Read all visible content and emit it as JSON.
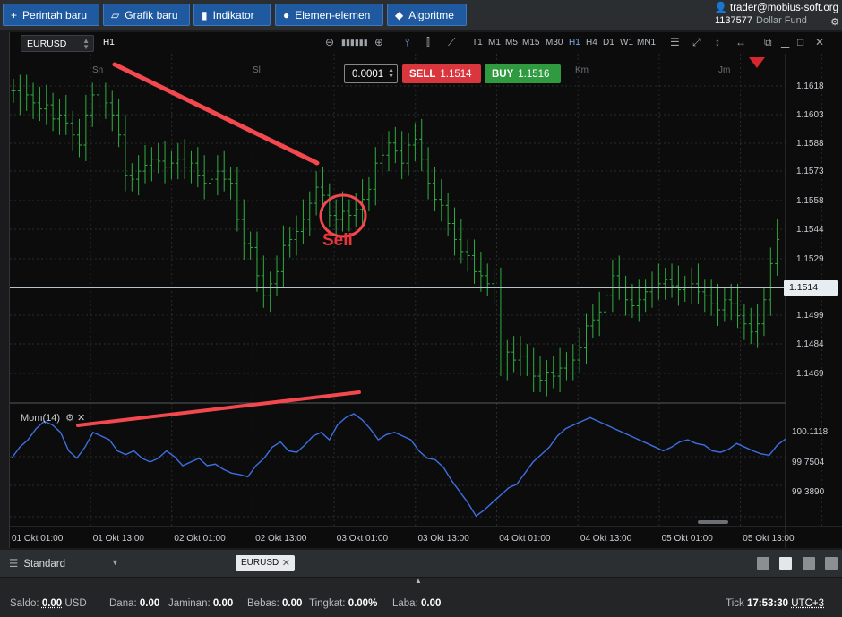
{
  "toolbar": {
    "new_order": "Perintah baru",
    "new_chart": "Grafik baru",
    "indicator": "Indikator",
    "elements": "Elemen-elemen",
    "algorithm": "Algoritme"
  },
  "account": {
    "user": "trader@mobius-soft.org",
    "account_id": "1137577",
    "fund_name": "Dollar Fund"
  },
  "chart": {
    "symbol": "EURUSD",
    "period": "H1",
    "timeframes": [
      "T1",
      "M1",
      "M5",
      "M15",
      "M30",
      "H1",
      "H4",
      "D1",
      "W1",
      "MN1"
    ],
    "active_timeframe": "H1",
    "day_labels": [
      "Sn",
      "Sl",
      "Km",
      "Jm"
    ],
    "y_ticks": [
      "1.1618",
      "1.1603",
      "1.1588",
      "1.1573",
      "1.1558",
      "1.1544",
      "1.1529",
      "1.1499",
      "1.1484",
      "1.1469"
    ],
    "current_price": "1.1514",
    "trade": {
      "quantity": "0.0001",
      "sell_label": "SELL",
      "sell_price": "1.1514",
      "buy_label": "BUY",
      "buy_price": "1.1516"
    },
    "annotation_text": "Sell",
    "indicator_label": "Mom(14)",
    "indicator_ticks": [
      "100.1118",
      "99.7504",
      "99.3890"
    ],
    "x_labels": [
      "01 Okt 01:00",
      "01 Okt 13:00",
      "02 Okt 01:00",
      "02 Okt 13:00",
      "03 Okt 01:00",
      "03 Okt 13:00",
      "04 Okt 01:00",
      "04 Okt 13:00",
      "05 Okt 01:00",
      "05 Okt 13:00"
    ],
    "colors": {
      "candle": "#2fae3f",
      "momentum": "#3d6fe0",
      "annotation": "#f2484e",
      "price_line": "#b9c2c8"
    }
  },
  "bottom": {
    "workspace": "Standard",
    "open_tab": "EURUSD"
  },
  "status": {
    "saldo_label": "Saldo:",
    "saldo": "0.00",
    "currency": "USD",
    "dana_label": "Dana:",
    "dana": "0.00",
    "jaminan_label": "Jaminan:",
    "jaminan": "0.00",
    "bebas_label": "Bebas:",
    "bebas": "0.00",
    "tingkat_label": "Tingkat:",
    "tingkat": "0.00%",
    "laba_label": "Laba:",
    "laba": "0.00",
    "tick_label": "Tick",
    "time": "17:53:30",
    "timezone": "UTC+3"
  }
}
